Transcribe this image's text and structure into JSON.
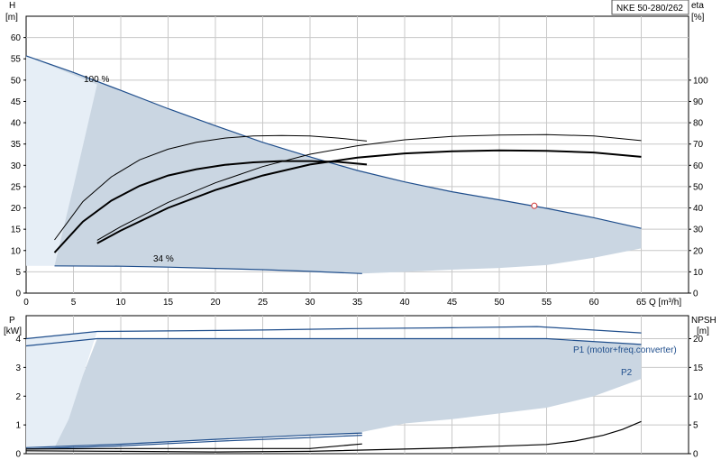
{
  "chart_data": [
    {
      "type": "line",
      "title": "NKE 50-280/262",
      "ylabel_left": "H",
      "ylabel_left_unit": "[m]",
      "ylabel_right": "eta",
      "ylabel_right_unit": "[%]",
      "xlabel": "Q [m³/h]",
      "xlim": [
        0,
        70
      ],
      "ylim_left": [
        0,
        65
      ],
      "ylim_right": [
        0,
        130
      ],
      "x_ticks": [
        0,
        5,
        10,
        15,
        20,
        25,
        30,
        35,
        40,
        45,
        50,
        55,
        60,
        65
      ],
      "y_ticks_left": [
        0,
        5,
        10,
        15,
        20,
        25,
        30,
        35,
        40,
        45,
        50,
        55,
        60
      ],
      "y_ticks_right": [
        0,
        10,
        20,
        30,
        40,
        50,
        60,
        70,
        80,
        90,
        100
      ],
      "annotations": [
        "100 %",
        "34 %"
      ],
      "grid": true,
      "series": [
        {
          "name": "100 %",
          "axis": "left",
          "color": "#1f4e8c",
          "x": [
            0,
            5,
            10,
            15,
            20,
            25,
            30,
            35,
            40,
            45,
            50,
            55,
            60,
            65
          ],
          "y": [
            55.7,
            51.8,
            47.6,
            43.3,
            39.3,
            35.4,
            32.0,
            28.8,
            26.1,
            23.8,
            21.9,
            19.9,
            17.7,
            15.2
          ]
        },
        {
          "name": "34 %",
          "axis": "left",
          "color": "#1f4e8c",
          "x": [
            3,
            10,
            15,
            20,
            25,
            30,
            35.5
          ],
          "y": [
            6.4,
            6.3,
            6.1,
            5.8,
            5.5,
            5.1,
            4.6
          ]
        },
        {
          "axis": "left",
          "color": "#000000",
          "width": 2,
          "x": [
            3,
            6,
            9,
            12,
            15,
            18,
            21,
            24,
            27,
            30,
            33,
            36
          ],
          "y": [
            9.5,
            16.8,
            21.7,
            25.2,
            27.6,
            29.1,
            30.1,
            30.7,
            31.0,
            31.0,
            30.8,
            30.2
          ]
        },
        {
          "axis": "left",
          "color": "#000000",
          "width": 2,
          "x": [
            7.5,
            10,
            15,
            20,
            25,
            30,
            35,
            40,
            45,
            50,
            55,
            60,
            65
          ],
          "y": [
            11.7,
            14.7,
            20.0,
            24.2,
            27.6,
            30.2,
            31.8,
            32.8,
            33.3,
            33.5,
            33.4,
            33.0,
            32.0
          ]
        },
        {
          "axis": "left",
          "color": "#000000",
          "width": 1,
          "x": [
            3,
            6,
            9,
            12,
            15,
            18,
            21,
            24,
            27,
            30,
            33,
            36
          ],
          "y": [
            12.5,
            21.5,
            27.3,
            31.3,
            33.8,
            35.4,
            36.4,
            36.9,
            37.0,
            36.9,
            36.4,
            35.7
          ]
        },
        {
          "axis": "left",
          "color": "#000000",
          "width": 1,
          "x": [
            7.5,
            10,
            15,
            20,
            25,
            30,
            35,
            40,
            45,
            50,
            55,
            60,
            65
          ],
          "y": [
            12.4,
            15.6,
            21.3,
            25.9,
            29.7,
            32.6,
            34.6,
            36.0,
            36.8,
            37.1,
            37.2,
            36.9,
            35.8
          ]
        }
      ],
      "envelope": {
        "color": "#cad6e2",
        "upper_x": [
          0,
          5,
          10,
          15,
          20,
          25,
          30,
          35,
          40,
          45,
          50,
          55,
          60,
          65
        ],
        "upper_y": [
          55.7,
          51.8,
          47.6,
          43.3,
          39.3,
          35.4,
          32.0,
          28.8,
          26.1,
          23.8,
          21.9,
          19.9,
          17.7,
          15.2
        ],
        "lower_x": [
          65,
          60,
          55,
          50,
          45,
          40,
          35.5,
          30,
          20,
          10,
          3
        ],
        "lower_y": [
          10.5,
          8.3,
          6.6,
          5.9,
          5.5,
          5.0,
          4.6,
          5.1,
          5.8,
          6.3,
          6.4
        ]
      },
      "markers": [
        {
          "x": 53.7,
          "y": 20.5,
          "style": "open-circle",
          "color": "#d03030"
        }
      ]
    },
    {
      "type": "line",
      "ylabel_left": "P",
      "ylabel_left_unit": "[kW]",
      "ylabel_right": "NPSH",
      "ylabel_right_unit": "[m]",
      "xlim": [
        0,
        70
      ],
      "ylim_left": [
        0,
        4.8
      ],
      "ylim_right": [
        0,
        24
      ],
      "y_ticks_left": [
        0,
        1,
        2,
        3,
        4
      ],
      "y_ticks_right": [
        0,
        5,
        10,
        15,
        20
      ],
      "grid": true,
      "series": [
        {
          "name": "P1 (motor+freq.converter)",
          "axis": "left",
          "color": "#1f4e8c",
          "x": [
            0,
            7.5,
            15,
            25,
            35,
            45,
            54,
            65
          ],
          "y": [
            4.0,
            4.25,
            4.27,
            4.3,
            4.35,
            4.38,
            4.42,
            4.2
          ]
        },
        {
          "name": "P2",
          "axis": "left",
          "color": "#1f4e8c",
          "x": [
            0,
            7.5,
            15,
            25,
            35,
            45,
            55,
            65
          ],
          "y": [
            3.75,
            4.0,
            4.0,
            4.0,
            4.0,
            4.0,
            4.0,
            3.8
          ]
        },
        {
          "axis": "left",
          "color": "#1f4e8c",
          "x": [
            0,
            10,
            20,
            30,
            35.5
          ],
          "y": [
            0.21,
            0.33,
            0.5,
            0.65,
            0.72
          ]
        },
        {
          "axis": "left",
          "color": "#1f4e8c",
          "x": [
            0,
            10,
            20,
            30,
            35.5
          ],
          "y": [
            0.16,
            0.27,
            0.43,
            0.56,
            0.64
          ]
        },
        {
          "axis": "right",
          "color": "#000000",
          "x": [
            0,
            10,
            20,
            30,
            35.5
          ],
          "y": [
            0.8,
            0.9,
            0.9,
            0.9,
            1.7
          ]
        },
        {
          "axis": "right",
          "color": "#000000",
          "x": [
            0,
            10,
            20,
            30,
            40,
            45,
            50,
            55,
            58,
            61,
            63,
            65
          ],
          "y": [
            0.5,
            0.4,
            0.3,
            0.4,
            0.8,
            1.0,
            1.3,
            1.6,
            2.2,
            3.2,
            4.2,
            5.6
          ]
        }
      ],
      "envelope": {
        "color": "#cad6e2",
        "upper_x": [
          7.5,
          15,
          25,
          35,
          45,
          54,
          65
        ],
        "upper_y": [
          4.0,
          4.0,
          4.0,
          4.0,
          4.0,
          4.0,
          3.8
        ],
        "lower_x": [
          65,
          60,
          55,
          50,
          45,
          40,
          35,
          30,
          20,
          10,
          3
        ],
        "lower_y": [
          2.6,
          2.0,
          1.6,
          1.4,
          1.2,
          1.05,
          0.72,
          0.65,
          0.5,
          0.33,
          0.21
        ]
      }
    }
  ],
  "labels": {
    "series_p1": "P1 (motor+freq.converter)",
    "series_p2": "P2"
  }
}
